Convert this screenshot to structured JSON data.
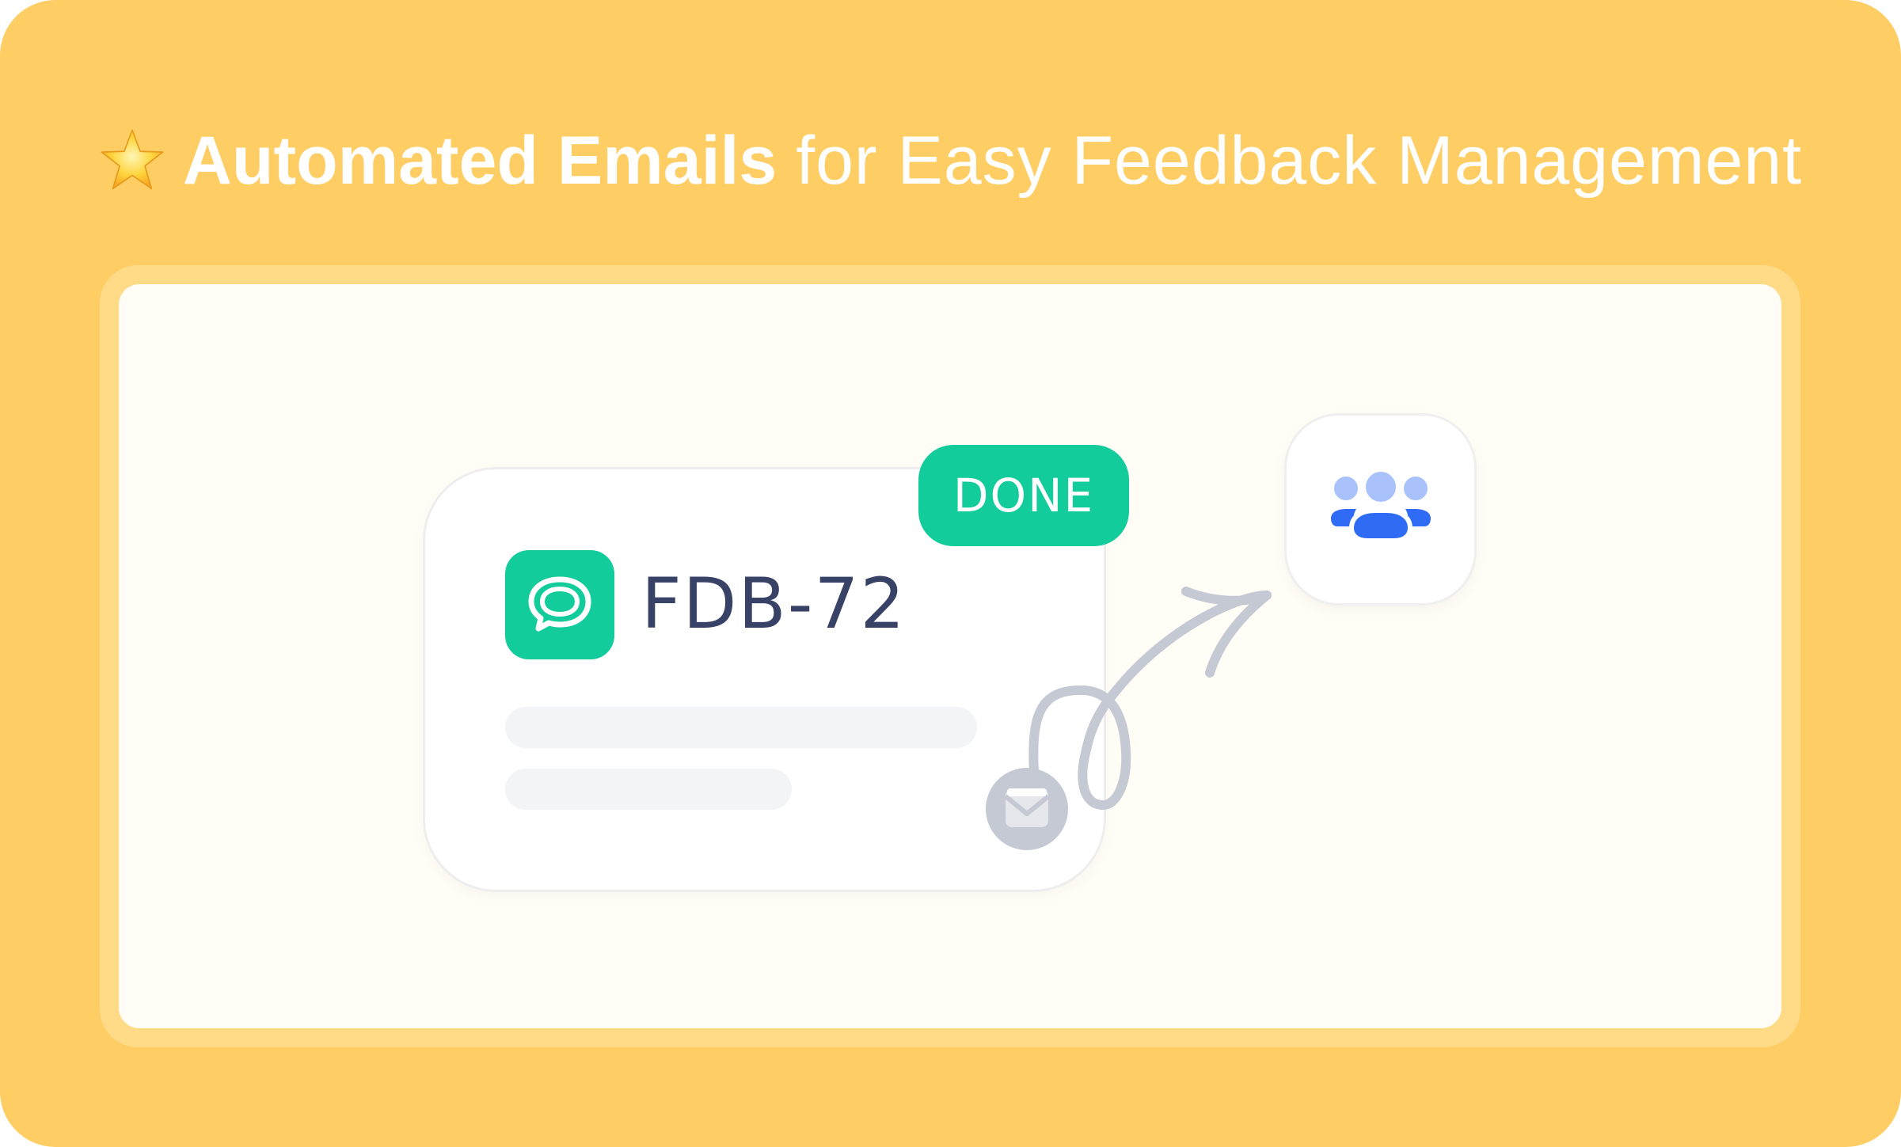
{
  "headline": {
    "bold": "Automated Emails",
    "light": "for Easy Feedback Management"
  },
  "card": {
    "id": "FDB-72",
    "status": "DONE"
  },
  "colors": {
    "background": "#FECD63",
    "accent_green": "#12CC9B",
    "text_dark": "#384166",
    "team_blue": "#2F6BF5",
    "team_blue_light": "#A9C2FB",
    "connector_gray": "#C5C9D3"
  },
  "icons": {
    "headline": "star-icon",
    "card": "chat-bubble-icon",
    "mail": "envelope-icon",
    "team": "team-icon"
  }
}
